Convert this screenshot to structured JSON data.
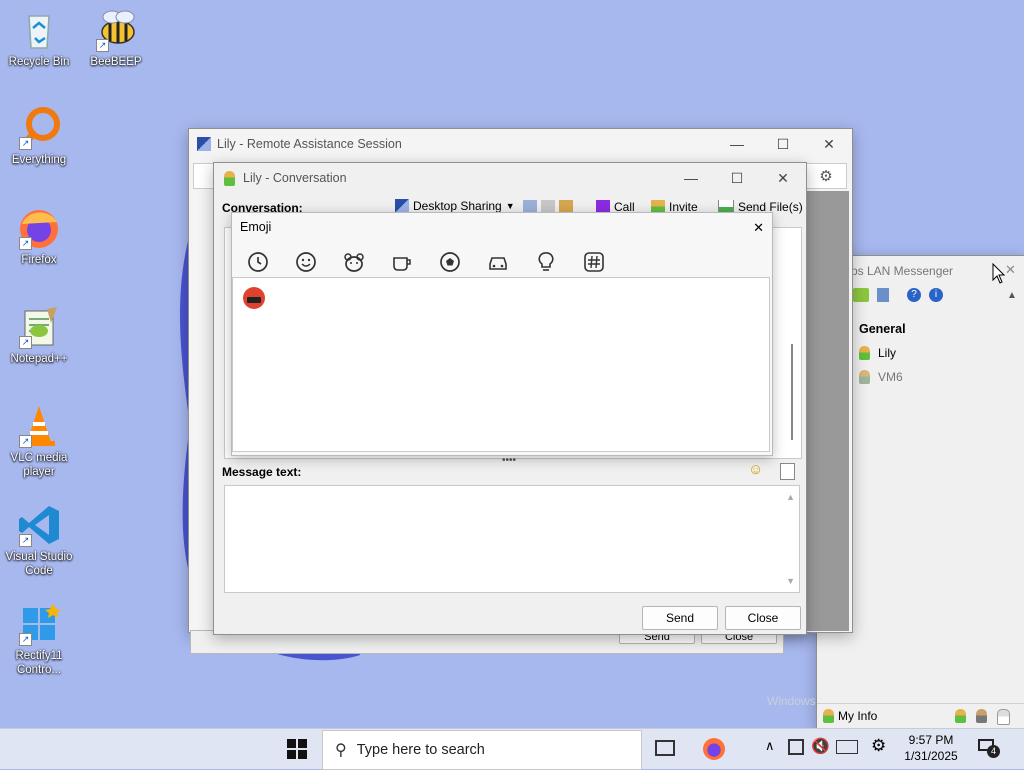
{
  "desktop": {
    "icons": [
      {
        "label": "Recycle Bin"
      },
      {
        "label": "BeeBEEP"
      },
      {
        "label": "Everything"
      },
      {
        "label": "Firefox"
      },
      {
        "label": "Notepad++"
      },
      {
        "label": "VLC media player"
      },
      {
        "label": "Visual Studio Code"
      },
      {
        "label": "Rectify11 Contro..."
      }
    ]
  },
  "remote_window": {
    "title": "Lily - Remote Assistance Session",
    "bottom_buttons": {
      "send": "Send",
      "close": "Close"
    }
  },
  "conversation_window": {
    "title": "Lily - Conversation",
    "conversation_label": "Conversation:",
    "toolbar": {
      "desktop_sharing": "Desktop Sharing",
      "call": "Call",
      "invite": "Invite",
      "send_files": "Send File(s)"
    },
    "message_label": "Message text:",
    "message_value": "",
    "send_button": "Send",
    "close_button": "Close"
  },
  "emoji_dialog": {
    "title": "Emoji",
    "close_glyph": "✕",
    "tabs": [
      "recent-icon",
      "smiley-icon",
      "animal-icon",
      "food-icon",
      "activity-icon",
      "travel-icon",
      "objects-icon",
      "symbols-icon"
    ],
    "selected_tab": "recent",
    "recent_emojis": [
      "🤬"
    ]
  },
  "lan_messenger": {
    "title": "ps LAN Messenger",
    "group": "General",
    "users": [
      {
        "name": "Lily",
        "status": "online"
      },
      {
        "name": "VM6",
        "status": "offline"
      }
    ],
    "my_info": "My Info"
  },
  "watermark": "Windows",
  "taskbar": {
    "search_placeholder": "Type here to search",
    "time": "9:57 PM",
    "date": "1/31/2025",
    "notification_count": "4"
  },
  "colors": {
    "desktop_bg": "#a7b8ef",
    "accent_blue": "#0078d4"
  }
}
